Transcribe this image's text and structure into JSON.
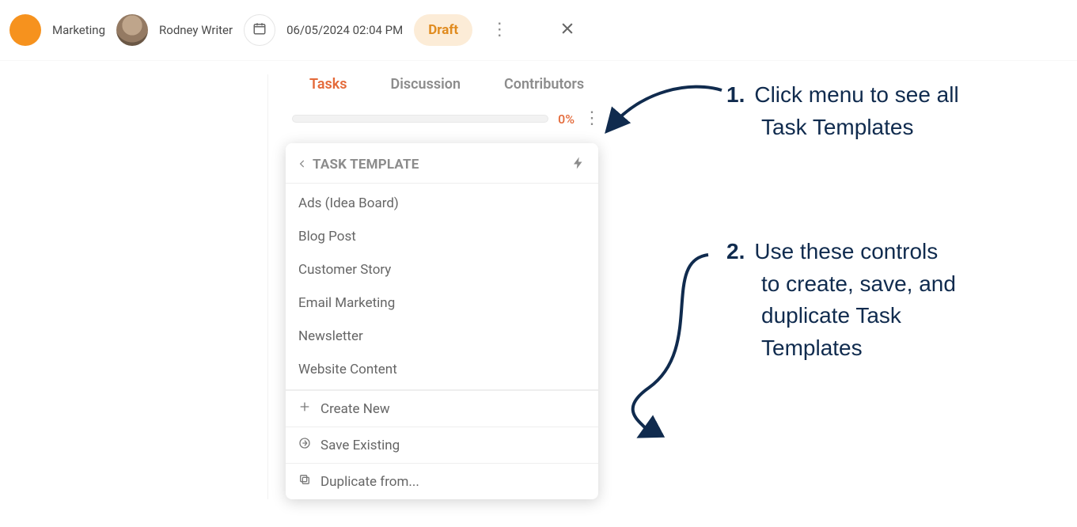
{
  "topbar": {
    "category_label": "Marketing",
    "author_name": "Rodney Writer",
    "datetime": "06/05/2024 02:04 PM",
    "status_label": "Draft"
  },
  "panel": {
    "tabs": {
      "tasks": "Tasks",
      "discussion": "Discussion",
      "contributors": "Contributors"
    },
    "progress_pct": "0%"
  },
  "template_dropdown": {
    "header_title": "TASK TEMPLATE",
    "templates": [
      "Ads (Idea Board)",
      "Blog Post",
      "Customer Story",
      "Email Marketing",
      "Newsletter",
      "Website Content"
    ],
    "actions": {
      "create_new": "Create New",
      "save_existing": "Save Existing",
      "duplicate_from": "Duplicate from..."
    }
  },
  "annotations": {
    "a1_num": "1.",
    "a1_line1": "Click menu to see all",
    "a1_line2": "Task Templates",
    "a2_num": "2.",
    "a2_line1": "Use these controls",
    "a2_line2": "to create, save, and",
    "a2_line3": "duplicate Task",
    "a2_line4": "Templates"
  }
}
